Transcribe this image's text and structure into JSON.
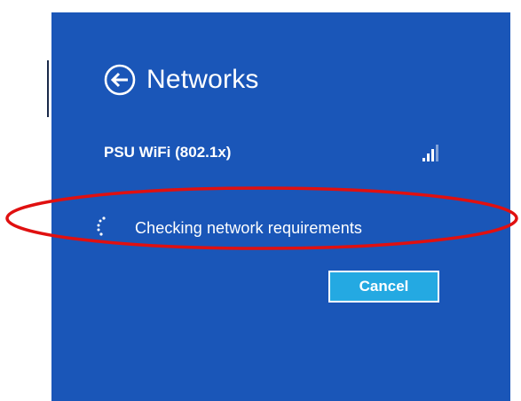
{
  "panel": {
    "title": "Networks",
    "background_color": "#1a56b8"
  },
  "network": {
    "name": "PSU WiFi (802.1x)",
    "signal_icon": "wifi-signal-bars-icon"
  },
  "status": {
    "text": "Checking network requirements",
    "icon": "loading-spinner-icon"
  },
  "actions": {
    "cancel_label": "Cancel",
    "cancel_color": "#24a9e2"
  },
  "annotation": {
    "shape": "ellipse",
    "color": "#e01010"
  }
}
